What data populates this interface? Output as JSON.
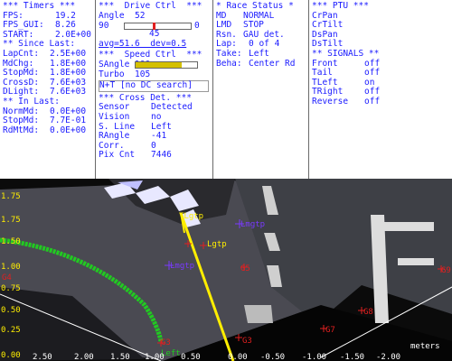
{
  "timers": {
    "title": "*** Timers ***",
    "rows": [
      {
        "label": "FPS:",
        "value": "19.2"
      },
      {
        "label": "FPS_GUI:",
        "value": "8.26"
      },
      {
        "label": "START:",
        "value": "2.0E+00"
      }
    ],
    "since_title": "** Since Last:",
    "since_rows": [
      {
        "label": "LapCnt:",
        "value": "2.5E+00"
      },
      {
        "label": "MdChg:",
        "value": "1.8E+00"
      },
      {
        "label": "StopMd:",
        "value": "1.8E+00"
      },
      {
        "label": "CrossD:",
        "value": "7.6E+03"
      },
      {
        "label": "DLight:",
        "value": "7.6E+03"
      }
    ],
    "in_title": "** In Last:",
    "in_rows": [
      {
        "label": "NormMd:",
        "value": "0.0E+00"
      },
      {
        "label": "StopMd:",
        "value": "7.7E-01"
      },
      {
        "label": "RdMtMd:",
        "value": "0.0E+00"
      }
    ]
  },
  "drive": {
    "title": "***  Drive Ctrl  ***",
    "angle_label": "Angle",
    "angle_value": "52",
    "gauge_min": "90",
    "gauge_max": "0",
    "gauge_level": 0.42,
    "gauge_center": "45",
    "avg": "avg=51.6  dev=0.5",
    "speed_title": "***  Speed Ctrl  ***",
    "speed_label": "SAngle",
    "speed_value": "100",
    "speed_level": 0.75,
    "turbo_label": "Turbo",
    "turbo_value": "105",
    "nt": "N+T [no DC search]",
    "cross_title": "*** Cross Det. ***",
    "cross_rows": [
      {
        "label": "Sensor",
        "value": "Detected"
      },
      {
        "label": "Vision",
        "value": "no"
      },
      {
        "label": "S. Line",
        "value": "Left"
      },
      {
        "label": "RAngle",
        "value": "-41"
      },
      {
        "label": "Corr.",
        "value": "0"
      },
      {
        "label": "Pix Cnt",
        "value": "7446"
      }
    ]
  },
  "race": {
    "title": "* Race Status *",
    "rows": [
      {
        "label": "MD",
        "value": "NORMAL"
      },
      {
        "label": "LMD",
        "value": "STOP"
      },
      {
        "label": "Rsn.",
        "value": "GAU det."
      },
      {
        "label": "Lap:",
        "value": "0 of 4"
      },
      {
        "label": "Take:",
        "value": "Left"
      },
      {
        "label": "Beha:",
        "value": "Center Rd"
      }
    ]
  },
  "ptu": {
    "title": "*** PTU ***",
    "items": [
      "CrPan",
      "CrTilt",
      "DsPan",
      "DsTilt"
    ],
    "signals_title": "** SIGNALS **",
    "signals": [
      {
        "label": "Front",
        "value": "off"
      },
      {
        "label": "Tail",
        "value": "off"
      },
      {
        "label": "TLeft",
        "value": "on"
      },
      {
        "label": "TRight",
        "value": "off"
      },
      {
        "label": "Reverse",
        "value": "off"
      }
    ]
  },
  "camera": {
    "y_labels": [
      "1.75",
      "1.50",
      "1.25",
      "1.00",
      "0.75",
      "0.50",
      "0.25",
      "0.00"
    ],
    "x_labels": [
      "2.50",
      "2.00",
      "1.50",
      "1.00",
      "0.50",
      "0.00",
      "-0.50",
      "-1.00",
      "-1.50",
      "-2.00"
    ],
    "units": "meters",
    "annot": {
      "tlgtp": "TLgtp",
      "lmgtp": "Lmgtp",
      "lgtp": "Lgtp",
      "lmgtp_mid": "Lmgtp",
      "g3": "G3",
      "left": "Left",
      "g3_right": "G3",
      "g4": "G4",
      "g5": "G5",
      "g7": "G7",
      "g8": "G8",
      "g9": "G9"
    },
    "colors": {
      "lane": "#22c922",
      "path": "#ffee00",
      "marker": "#e02020",
      "target": "#7a3aff"
    }
  }
}
